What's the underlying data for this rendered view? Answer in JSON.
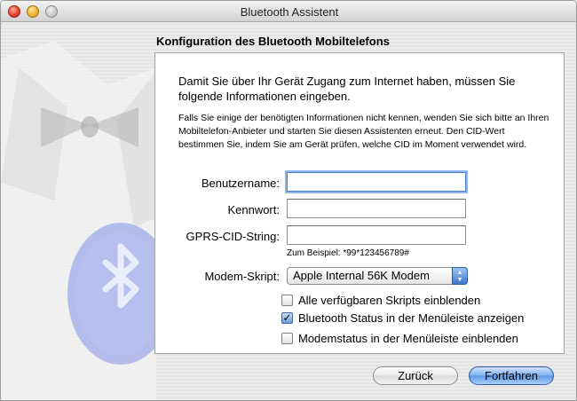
{
  "window": {
    "title": "Bluetooth Assistent"
  },
  "heading": "Konfiguration des Bluetooth Mobiltelefons",
  "intro_text": "Damit Sie über Ihr Gerät Zugang zum Internet haben, müssen Sie folgende Informationen eingeben.",
  "note_text": "Falls Sie einige der benötigten Informationen nicht kennen, wenden Sie sich bitte an Ihren Mobiltelefon-Anbieter und starten Sie diesen Assistenten erneut. Den CID-Wert bestimmen Sie, indem Sie am Gerät prüfen, welche CID im Moment verwendet wird.",
  "fields": {
    "username": {
      "label": "Benutzername:",
      "value": ""
    },
    "password": {
      "label": "Kennwort:",
      "value": ""
    },
    "gprs_cid": {
      "label": "GPRS-CID-String:",
      "value": "",
      "hint": "Zum Beispiel: *99*123456789#"
    }
  },
  "modem_script": {
    "label": "Modem-Skript:",
    "selected": "Apple Internal 56K Modem"
  },
  "checkboxes": [
    {
      "label": "Alle verfügbaren Skripts einblenden",
      "checked": false
    },
    {
      "label": "Bluetooth Status in der Menüleiste anzeigen",
      "checked": true
    },
    {
      "label": "Modemstatus in der Menüleiste einblenden",
      "checked": false
    }
  ],
  "buttons": {
    "back": "Zurück",
    "continue": "Fortfahren"
  },
  "icons": {
    "check_glyph": "✓",
    "popup_up": "▲",
    "popup_down": "▼"
  }
}
